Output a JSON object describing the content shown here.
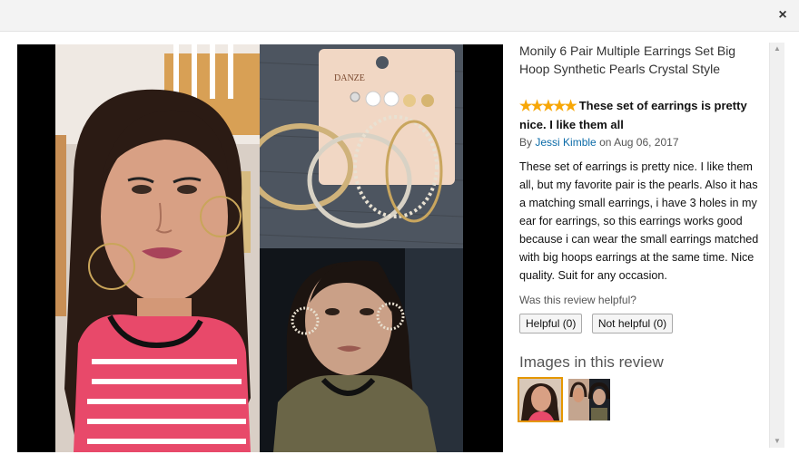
{
  "dialog": {
    "close_glyph": "×"
  },
  "review": {
    "product_title": "Monily 6 Pair Multiple Earrings Set Big Hoop Synthetic Pearls Crystal Style",
    "star_glyphs": "★★★★★",
    "rating": 5,
    "headline": "These set of earrings is pretty nice. I like them all",
    "by_prefix": "By",
    "author": "Jessi Kimble",
    "date_prefix": "on",
    "date": "Aug 06, 2017",
    "body": "These set of earrings is pretty nice. I like them all, but my favorite pair is the pearls. Also it has a matching small earrings, i have 3 holes in my ear for earrings, so this earrings works good because i can wear the small earrings matched with big hoops earrings at the same time. Nice quality. Suit for any occasion.",
    "helpful_question": "Was this review helpful?",
    "helpful_button": "Helpful (0)",
    "not_helpful_button": "Not helpful (0)",
    "images_heading": "Images in this review"
  },
  "photo": {
    "brand_text": "DANZE"
  },
  "colors": {
    "star": "#f7a707",
    "link": "#0b6ba8",
    "selected_thumb": "#e59700"
  },
  "icons": [
    "close-icon",
    "star-icon",
    "scroll-up-icon",
    "scroll-down-icon"
  ]
}
